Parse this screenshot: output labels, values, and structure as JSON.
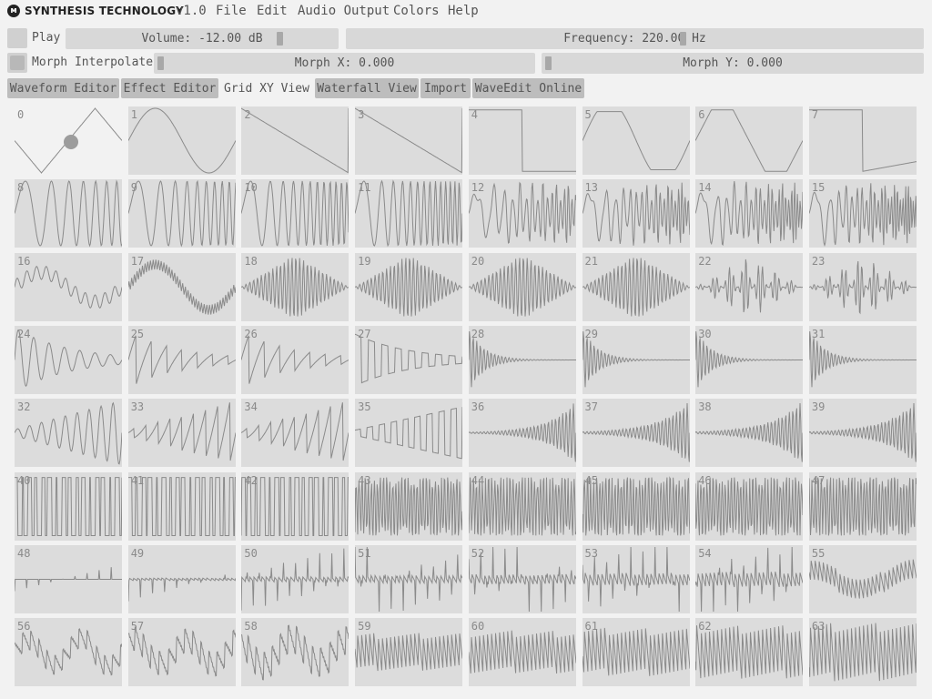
{
  "app": {
    "brand": "SYNTHESIS TECHNOLOGY",
    "version": "v1.0"
  },
  "menu": [
    "File",
    "Edit",
    "Audio Output",
    "Colors",
    "Help"
  ],
  "controls": {
    "play_label": "Play",
    "volume_label": "Volume: -12.00 dB",
    "frequency_label": "Frequency: 220.00 Hz",
    "morph_interpolate_label": "Morph Interpolate",
    "morph_x_label": "Morph X: 0.000",
    "morph_y_label": "Morph Y: 0.000"
  },
  "tabs": [
    "Waveform Editor",
    "Effect Editor",
    "Grid XY View",
    "Waterfall View",
    "Import",
    "WaveEdit Online"
  ],
  "active_tab": "Grid XY View",
  "wave_colors": {
    "line": "#8a8a8a",
    "cell_bg": "#dcdcdc"
  },
  "wave_count": 64,
  "wave_numbers": [
    "0",
    "1",
    "2",
    "3",
    "4",
    "5",
    "6",
    "7",
    "8",
    "9",
    "10",
    "11",
    "12",
    "13",
    "14",
    "15",
    "16",
    "17",
    "18",
    "19",
    "20",
    "21",
    "22",
    "23",
    "24",
    "25",
    "26",
    "27",
    "28",
    "29",
    "30",
    "31",
    "32",
    "33",
    "34",
    "35",
    "36",
    "37",
    "38",
    "39",
    "40",
    "41",
    "42",
    "43",
    "44",
    "45",
    "46",
    "47",
    "48",
    "49",
    "50",
    "51",
    "52",
    "53",
    "54",
    "55",
    "56",
    "57",
    "58",
    "59",
    "60",
    "61",
    "62",
    "63"
  ]
}
